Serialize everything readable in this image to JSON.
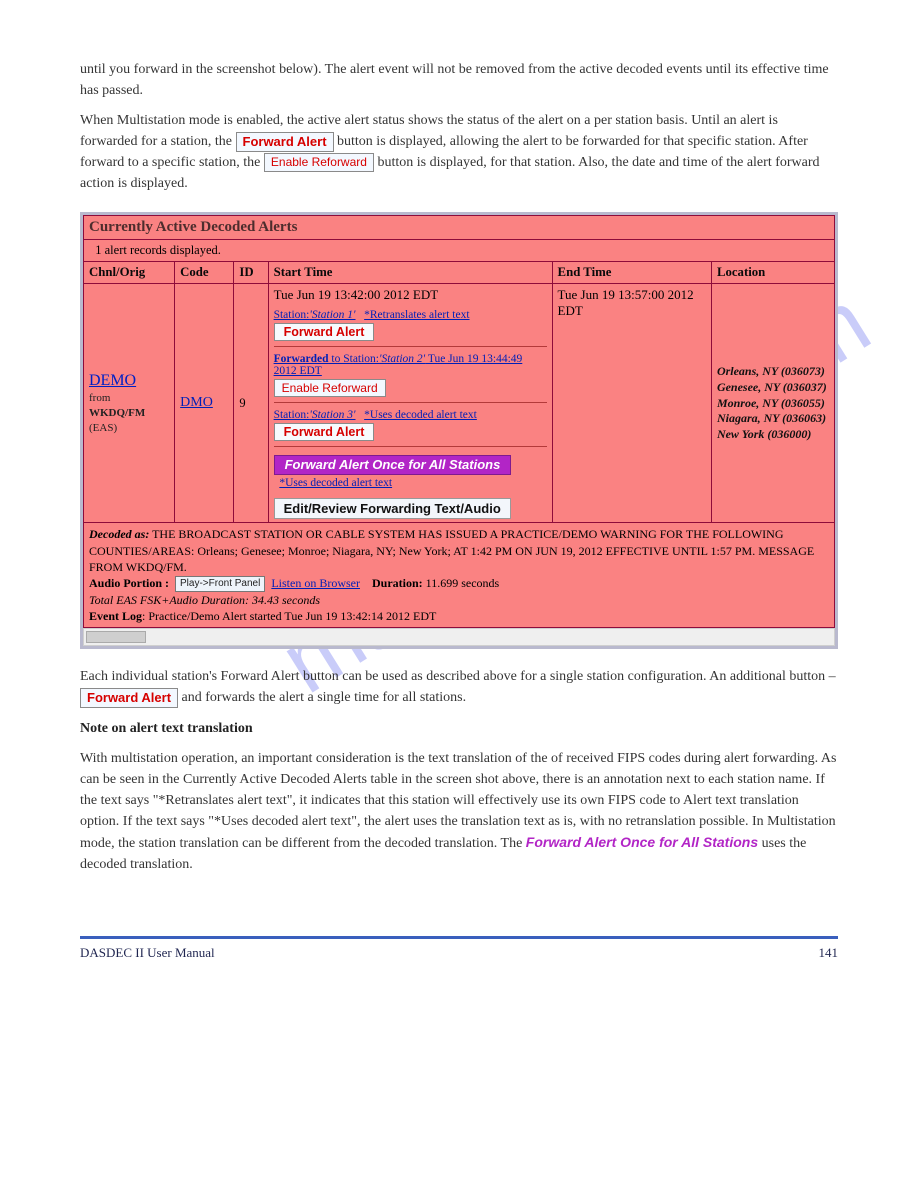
{
  "intro": {
    "hover": "until you forward in the screenshot below). The alert event will not be removed from the active decoded events until its effective time has passed.",
    "p1a": "When Multistation mode is enabled, the active alert status shows the status of the alert on a per station basis. Until an alert is forwarded for a station, the ",
    "p1b": " button is displayed, allowing the alert to be forwarded for that specific station. After forward to a specific station, the ",
    "p1c": " button is displayed, for that station. Also, the date and time of the alert forward action is displayed."
  },
  "screenshot": {
    "title": "Currently Active Decoded Alerts",
    "status": "1 alert records displayed.",
    "headers": {
      "chnl": "Chnl/Orig",
      "code": "Code",
      "id": "ID",
      "start": "Start Time",
      "end": "End Time",
      "loc": "Location"
    },
    "row": {
      "chnl_link": "DEMO",
      "from_prefix": "from",
      "from_station": "WKDQ/FM",
      "from_suffix": "(EAS)",
      "code": "DMO",
      "id": "9",
      "start_time": "Tue Jun 19 13:42:00 2012 EDT",
      "station1_label": "Station:",
      "station1_name": "'Station 1'",
      "station1_note": "*Retranslates alert text",
      "fwd_btn": "Forward Alert",
      "forwarded_label": "Forwarded",
      "forwarded_to": " to Station:",
      "station2_name": "'Station 2'",
      "forwarded_time": " Tue Jun 19 13:44:49 2012 EDT",
      "enable_refwd_btn": "Enable Reforward",
      "station3_label": "Station:",
      "station3_name": "'Station 3'",
      "station3_note": "*Uses decoded alert text",
      "fwd_all_btn": "Forward Alert Once for All Stations",
      "fwd_all_note": "*Uses decoded alert text",
      "edit_btn": "Edit/Review Forwarding Text/Audio",
      "end_time": "Tue Jun 19 13:57:00 2012 EDT",
      "locations": [
        "Orleans, NY (036073)",
        "Genesee, NY (036037)",
        "Monroe, NY (036055)",
        "Niagara, NY (036063)",
        "New York (036000)"
      ]
    },
    "decoded": {
      "label": "Decoded as:",
      "text": " THE BROADCAST STATION OR CABLE SYSTEM HAS ISSUED A PRACTICE/DEMO WARNING FOR THE FOLLOWING COUNTIES/AREAS: Orleans; Genesee; Monroe; Niagara, NY; New York; AT 1:42 PM ON JUN 19, 2012 EFFECTIVE UNTIL 1:57 PM. MESSAGE FROM WKDQ/FM.",
      "audio_label": "Audio Portion :",
      "play_btn": "Play->Front Panel",
      "listen": "Listen on Browser",
      "duration_label": "Duration:",
      "duration_val": " 11.699 seconds",
      "total": "Total EAS FSK+Audio Duration: 34.43 seconds",
      "eventlog_label": "Event Log",
      "eventlog_text": ": Practice/Demo Alert started Tue Jun 19 13:42:14 2012 EDT"
    }
  },
  "outro": {
    "p1a": "Each individual station's Forward Alert button can be used as described above for a single station configuration. An additional button – ",
    "p1b": " and forwards the alert a single time for all stations."
  },
  "note_title": "Note on alert text translation",
  "note_text": "With multistation operation, an important consideration is the text translation of the of received FIPS codes during alert forwarding. As can be seen in the Currently Active Decoded Alerts table in the screen shot above, there is an annotation next to each station name. If the text says \"*Retranslates alert text\", it indicates that this station will effectively use its own FIPS code to Alert text translation option. If the text says \"*Uses decoded alert text\", the alert uses the translation text as is, with no retranslation possible. In Multistation mode, the station translation can be different from the decoded translation. The ",
  "note_text2": " uses the decoded translation.",
  "fwd_all_inline": "Forward Alert Once for All Stations",
  "buttons": {
    "forward_alert": "Forward Alert",
    "enable_reforward": "Enable Reforward"
  },
  "watermark": "manualslive.com",
  "footer": {
    "title": "DASDEC II User Manual",
    "page": "141"
  }
}
